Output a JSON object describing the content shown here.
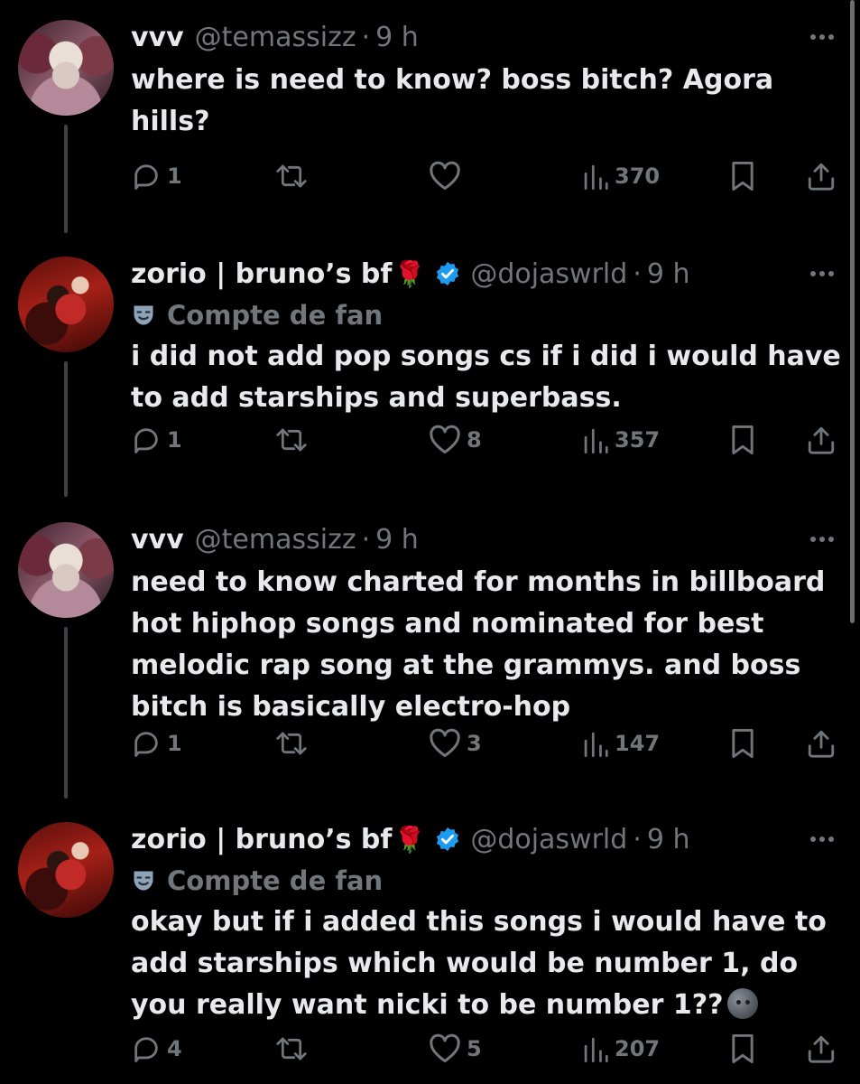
{
  "tweets": [
    {
      "name": "vvv",
      "handle": "@temassizz",
      "time": "9 h",
      "verified": false,
      "fan_label": "",
      "text": "where is need to know? boss bitch? Agora\nhills?",
      "replies": "1",
      "retweets": "",
      "likes": "",
      "views": "370"
    },
    {
      "name": "zorio | bruno’s bf",
      "handle": "@dojaswrld",
      "time": "9 h",
      "verified": true,
      "fan_label": "Compte de fan",
      "text": "i did not add pop songs cs if i did i would have\nto add starships and superbass.",
      "replies": "1",
      "retweets": "",
      "likes": "8",
      "views": "357"
    },
    {
      "name": "vvv",
      "handle": "@temassizz",
      "time": "9 h",
      "verified": false,
      "fan_label": "",
      "text": "need to know charted for months in billboard\nhot hiphop songs and nominated for best\nmelodic rap song at the grammys. and boss\nbitch is basically electro-hop",
      "replies": "1",
      "retweets": "",
      "likes": "3",
      "views": "147"
    },
    {
      "name": "zorio | bruno’s bf",
      "handle": "@dojaswrld",
      "time": "9 h",
      "verified": true,
      "fan_label": "Compte de fan",
      "text": "okay but if i added this songs i would have to\nadd starships which would be number 1, do\nyou really want nicki to be number 1??",
      "replies": "4",
      "retweets": "",
      "likes": "5",
      "views": "207"
    }
  ],
  "icons": {
    "rose": "🌹",
    "verified": "verified-badge-icon",
    "fan": "theater-mask-icon",
    "moon": "new-moon-face-emoji"
  },
  "colors": {
    "background": "#000000",
    "text": "#e7e9ea",
    "muted": "#71767b",
    "verified": "#1d9bf0",
    "thread_line": "#3e4144"
  }
}
